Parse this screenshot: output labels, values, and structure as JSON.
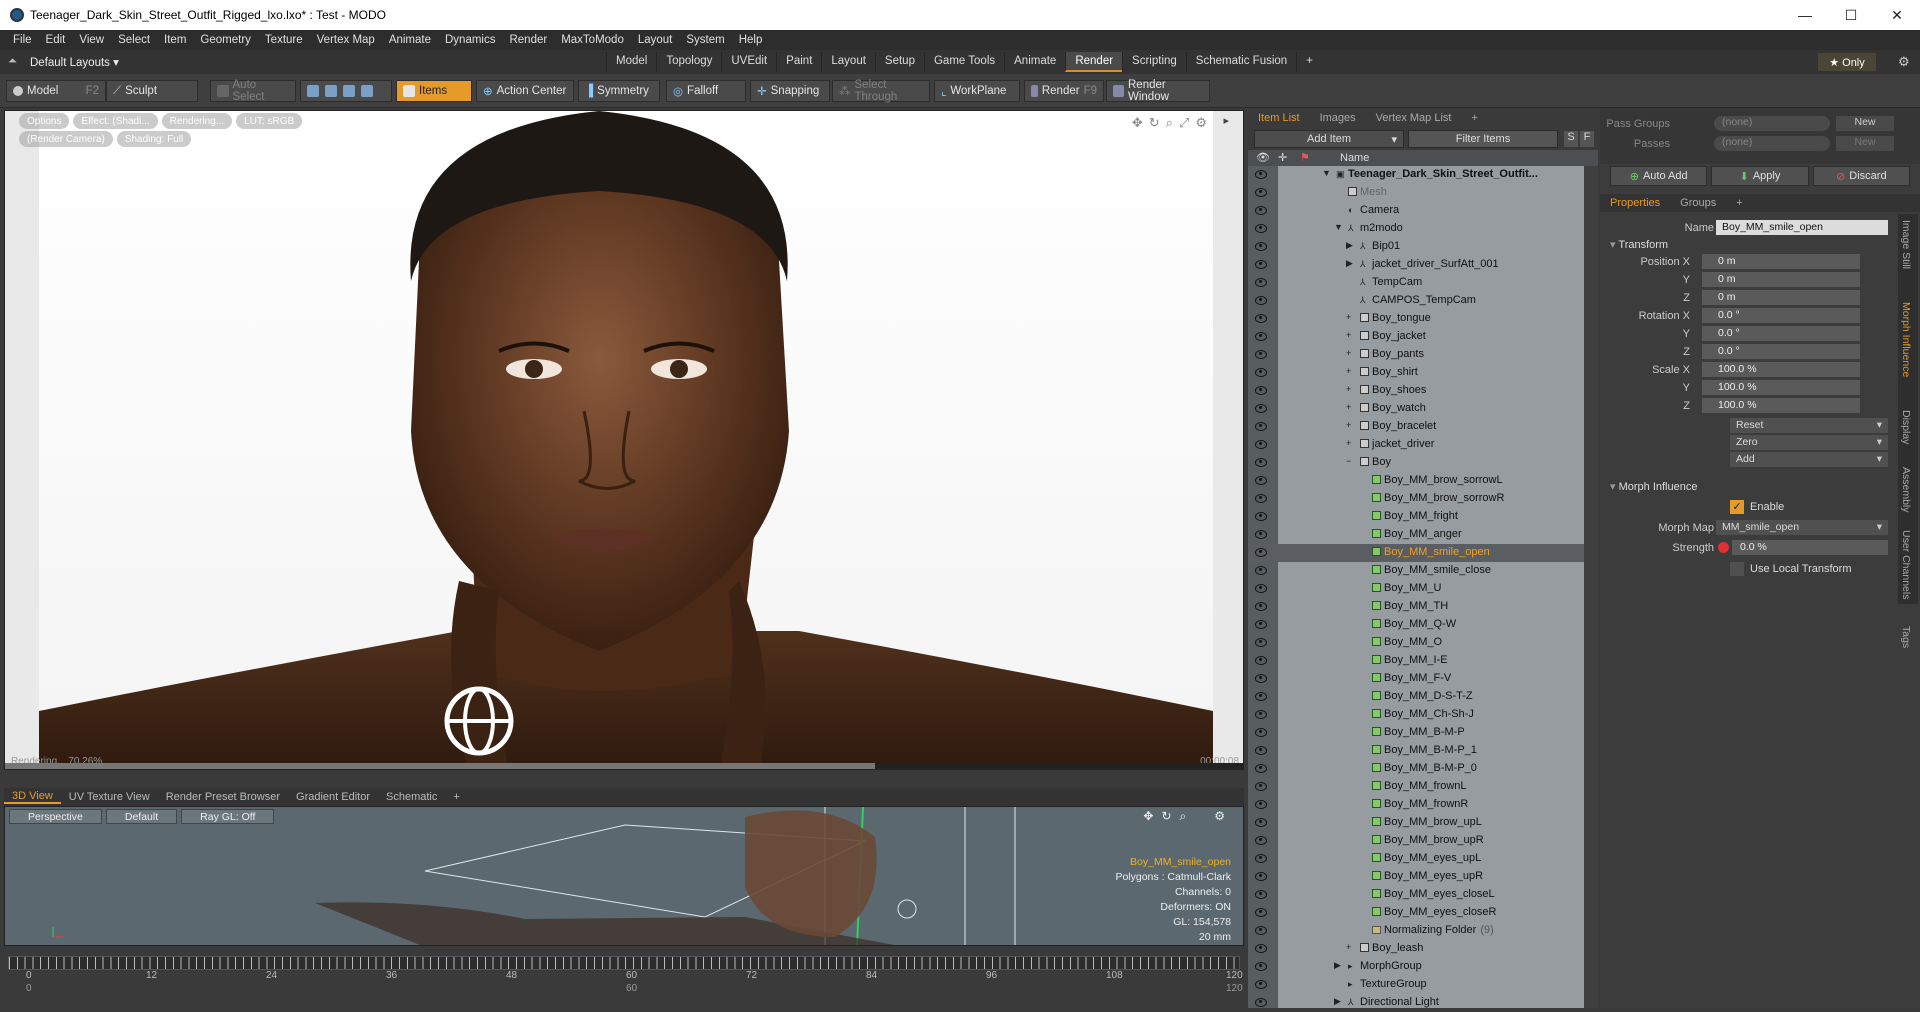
{
  "window": {
    "title": "Teenager_Dark_Skin_Street_Outfit_Rigged_lxo.lxo* : Test - MODO",
    "minimize": "—",
    "maximize": "☐",
    "close": "✕"
  },
  "menu": [
    "File",
    "Edit",
    "View",
    "Select",
    "Item",
    "Geometry",
    "Texture",
    "Vertex Map",
    "Animate",
    "Dynamics",
    "Render",
    "MaxToModo",
    "Layout",
    "System",
    "Help"
  ],
  "layout_selector": "Default Layouts ▾",
  "tabs": [
    "Model",
    "Topology",
    "UVEdit",
    "Paint",
    "Layout",
    "Setup",
    "Game Tools",
    "Animate",
    "Render",
    "Scripting",
    "Schematic Fusion",
    "+"
  ],
  "active_tab": "Render",
  "only_label": "★ Only",
  "toolbar": {
    "model": "Model",
    "model_key": "F2",
    "sculpt": "Sculpt",
    "auto_select": "Auto Select",
    "items": "Items",
    "action_center": "Action Center",
    "symmetry": "Symmetry",
    "falloff": "Falloff",
    "snapping": "Snapping",
    "select_through": "Select Through",
    "workplane": "WorkPlane",
    "render": "Render",
    "render_key": "F9",
    "render_window": "Render Window"
  },
  "viewport": {
    "tags_row1": [
      "Options",
      "Effect: (Shadi...",
      "Rendering...",
      "LUT: sRGB"
    ],
    "tags_row2": [
      "(Render Camera)",
      "Shading: Full"
    ],
    "rendering_status": "Rendering... 70.26%",
    "progress": 0.7026,
    "timecode": "00:00:08"
  },
  "lower_tabs": [
    "3D View",
    "UV Texture View",
    "Render Preset Browser",
    "Gradient Editor",
    "Schematic",
    "+"
  ],
  "view3d": {
    "buttons": [
      "Perspective",
      "Default",
      "Ray GL: Off"
    ],
    "info_selected": "Boy_MM_smile_open",
    "info_lines": [
      "Polygons : Catmull-Clark",
      "Channels: 0",
      "Deformers: ON",
      "GL: 154,578",
      "20 mm"
    ]
  },
  "timeline": {
    "labels": [
      "0",
      "12",
      "24",
      "36",
      "48",
      "60",
      "72",
      "84",
      "96",
      "108",
      "120"
    ],
    "labels2": [
      "0",
      "60",
      "120"
    ]
  },
  "item_list": {
    "tabs": [
      "Item List",
      "Images",
      "Vertex Map List",
      "+"
    ],
    "add_item": "Add Item",
    "filter_items": "Filter Items",
    "s_btn": "S",
    "f_btn": "F",
    "col_name": "Name",
    "rows": [
      {
        "label": "Teenager_Dark_Skin_Street_Outfit...",
        "indent": 0,
        "type": "scene",
        "bold": true,
        "exp": "▼"
      },
      {
        "label": "Mesh",
        "indent": 1,
        "type": "mesh",
        "dim": true
      },
      {
        "label": "Camera",
        "indent": 1,
        "type": "cam"
      },
      {
        "label": "m2modo",
        "indent": 1,
        "type": "loc",
        "exp": "▼"
      },
      {
        "label": "Bip01",
        "indent": 2,
        "type": "loc",
        "exp": "▶"
      },
      {
        "label": "jacket_driver_SurfAtt_001",
        "indent": 2,
        "type": "loc",
        "exp": "▶"
      },
      {
        "label": "TempCam",
        "indent": 2,
        "type": "loc"
      },
      {
        "label": "CAMPOS_TempCam",
        "indent": 2,
        "type": "loc"
      },
      {
        "label": "Boy_tongue",
        "indent": 2,
        "type": "mesh",
        "exp": "+"
      },
      {
        "label": "Boy_jacket",
        "indent": 2,
        "type": "mesh",
        "exp": "+"
      },
      {
        "label": "Boy_pants",
        "indent": 2,
        "type": "mesh",
        "exp": "+"
      },
      {
        "label": "Boy_shirt",
        "indent": 2,
        "type": "mesh",
        "exp": "+"
      },
      {
        "label": "Boy_shoes",
        "indent": 2,
        "type": "mesh",
        "exp": "+"
      },
      {
        "label": "Boy_watch",
        "indent": 2,
        "type": "mesh",
        "exp": "+"
      },
      {
        "label": "Boy_bracelet",
        "indent": 2,
        "type": "mesh",
        "exp": "+"
      },
      {
        "label": "jacket_driver",
        "indent": 2,
        "type": "mesh",
        "exp": "+"
      },
      {
        "label": "Boy",
        "indent": 2,
        "type": "mesh",
        "exp": "−"
      },
      {
        "label": "Boy_MM_brow_sorrowL",
        "indent": 3,
        "type": "morph"
      },
      {
        "label": "Boy_MM_brow_sorrowR",
        "indent": 3,
        "type": "morph"
      },
      {
        "label": "Boy_MM_fright",
        "indent": 3,
        "type": "morph"
      },
      {
        "label": "Boy_MM_anger",
        "indent": 3,
        "type": "morph"
      },
      {
        "label": "Boy_MM_smile_open",
        "indent": 3,
        "type": "morph",
        "sel": true
      },
      {
        "label": "Boy_MM_smile_close",
        "indent": 3,
        "type": "morph"
      },
      {
        "label": "Boy_MM_U",
        "indent": 3,
        "type": "morph"
      },
      {
        "label": "Boy_MM_TH",
        "indent": 3,
        "type": "morph"
      },
      {
        "label": "Boy_MM_Q-W",
        "indent": 3,
        "type": "morph"
      },
      {
        "label": "Boy_MM_O",
        "indent": 3,
        "type": "morph"
      },
      {
        "label": "Boy_MM_I-E",
        "indent": 3,
        "type": "morph"
      },
      {
        "label": "Boy_MM_F-V",
        "indent": 3,
        "type": "morph"
      },
      {
        "label": "Boy_MM_D-S-T-Z",
        "indent": 3,
        "type": "morph"
      },
      {
        "label": "Boy_MM_Ch-Sh-J",
        "indent": 3,
        "type": "morph"
      },
      {
        "label": "Boy_MM_B-M-P",
        "indent": 3,
        "type": "morph"
      },
      {
        "label": "Boy_MM_B-M-P_1",
        "indent": 3,
        "type": "morph"
      },
      {
        "label": "Boy_MM_B-M-P_0",
        "indent": 3,
        "type": "morph"
      },
      {
        "label": "Boy_MM_frownL",
        "indent": 3,
        "type": "morph"
      },
      {
        "label": "Boy_MM_frownR",
        "indent": 3,
        "type": "morph"
      },
      {
        "label": "Boy_MM_brow_upL",
        "indent": 3,
        "type": "morph"
      },
      {
        "label": "Boy_MM_brow_upR",
        "indent": 3,
        "type": "morph"
      },
      {
        "label": "Boy_MM_eyes_upL",
        "indent": 3,
        "type": "morph"
      },
      {
        "label": "Boy_MM_eyes_upR",
        "indent": 3,
        "type": "morph"
      },
      {
        "label": "Boy_MM_eyes_closeL",
        "indent": 3,
        "type": "morph"
      },
      {
        "label": "Boy_MM_eyes_closeR",
        "indent": 3,
        "type": "morph"
      },
      {
        "label": "Normalizing Folder",
        "indent": 3,
        "type": "folder",
        "count": "(9)"
      },
      {
        "label": "Boy_leash",
        "indent": 2,
        "type": "mesh",
        "exp": "+"
      },
      {
        "label": "MorphGroup",
        "indent": 1,
        "type": "group",
        "exp": "▶"
      },
      {
        "label": "TextureGroup",
        "indent": 1,
        "type": "group"
      },
      {
        "label": "Directional Light",
        "indent": 1,
        "type": "loc",
        "exp": "▶"
      }
    ]
  },
  "properties": {
    "pass_groups_label": "Pass Groups",
    "pass_groups_value": "(none)",
    "new1": "New",
    "passes_label": "Passes",
    "passes_value": "(none)",
    "new2": "New",
    "auto_add": "Auto Add",
    "apply": "Apply",
    "discard": "Discard",
    "tabs": [
      "Properties",
      "Groups",
      "+"
    ],
    "name_label": "Name",
    "name_value": "Boy_MM_smile_open",
    "transform_label": "Transform",
    "pos_x_label": "Position X",
    "pos_x": "0 m",
    "pos_y_label": "Y",
    "pos_y": "0 m",
    "pos_z_label": "Z",
    "pos_z": "0 m",
    "rot_x_label": "Rotation X",
    "rot_x": "0.0 °",
    "rot_y_label": "Y",
    "rot_y": "0.0 °",
    "rot_z_label": "Z",
    "rot_z": "0.0 °",
    "scl_x_label": "Scale X",
    "scl_x": "100.0 %",
    "scl_y_label": "Y",
    "scl_y": "100.0 %",
    "scl_z_label": "Z",
    "scl_z": "100.0 %",
    "reset": "Reset",
    "zero": "Zero",
    "add": "Add",
    "morph_influence_label": "Morph Influence",
    "enable_label": "Enable",
    "enable_checked": true,
    "morph_map_label": "Morph Map",
    "morph_map_value": "MM_smile_open",
    "strength_label": "Strength",
    "strength_value": "0.0 %",
    "use_local_transform": "Use Local Transform",
    "vertical_tabs": [
      "Image Still",
      "Morph Influence",
      "Display",
      "Assembly",
      "User Channels",
      "Tags"
    ],
    "active_vertical_tab": "Morph Influence"
  }
}
